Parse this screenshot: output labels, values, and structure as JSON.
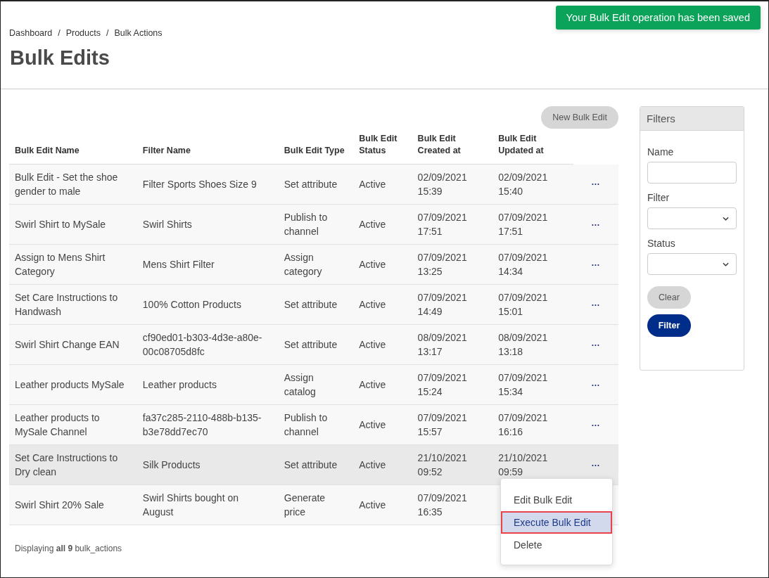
{
  "toast": {
    "text": "Your Bulk Edit operation has been saved"
  },
  "breadcrumb": [
    "Dashboard",
    "Products",
    "Bulk Actions"
  ],
  "breadcrumb_separator": "/",
  "title": "Bulk Edits",
  "new_button": "New Bulk Edit",
  "table": {
    "columns": [
      "Bulk Edit Name",
      "Filter Name",
      "Bulk Edit Type",
      "Bulk Edit Status",
      "Bulk Edit Created at",
      "Bulk Edit Updated at"
    ],
    "rows": [
      {
        "name": "Bulk Edit - Set the shoe gender to male",
        "filter": "Filter Sports Shoes Size 9",
        "type": "Set attribute",
        "status": "Active",
        "created": [
          "02/09/2021",
          "15:39"
        ],
        "updated": [
          "02/09/2021",
          "15:40"
        ],
        "actions": "···",
        "hovered": false
      },
      {
        "name": "Swirl Shirt to MySale",
        "filter": "Swirl Shirts",
        "type": "Publish to channel",
        "status": "Active",
        "created": [
          "07/09/2021",
          "17:51"
        ],
        "updated": [
          "07/09/2021",
          "17:51"
        ],
        "actions": "···",
        "hovered": false
      },
      {
        "name": "Assign to Mens Shirt Category",
        "filter": "Mens Shirt Filter",
        "type": "Assign category",
        "status": "Active",
        "created": [
          "07/09/2021",
          "13:25"
        ],
        "updated": [
          "07/09/2021",
          "14:34"
        ],
        "actions": "···",
        "hovered": false
      },
      {
        "name": "Set Care Instructions to Handwash",
        "filter": "100% Cotton Products",
        "type": "Set attribute",
        "status": "Active",
        "created": [
          "07/09/2021",
          "14:49"
        ],
        "updated": [
          "07/09/2021",
          "15:01"
        ],
        "actions": "···",
        "hovered": false
      },
      {
        "name": "Swirl Shirt Change EAN",
        "filter": "cf90ed01-b303-4d3e-a80e-00c08705d8fc",
        "type": "Set attribute",
        "status": "Active",
        "created": [
          "08/09/2021",
          "13:17"
        ],
        "updated": [
          "08/09/2021",
          "13:18"
        ],
        "actions": "···",
        "hovered": false
      },
      {
        "name": "Leather products MySale",
        "filter": "Leather products",
        "type": "Assign catalog",
        "status": "Active",
        "created": [
          "07/09/2021",
          "15:24"
        ],
        "updated": [
          "07/09/2021",
          "15:34"
        ],
        "actions": "···",
        "hovered": false
      },
      {
        "name": "Leather products to MySale Channel",
        "filter": "fa37c285-2110-488b-b135-b3e78dd7ec70",
        "type": "Publish to channel",
        "status": "Active",
        "created": [
          "07/09/2021",
          "15:57"
        ],
        "updated": [
          "07/09/2021",
          "16:16"
        ],
        "actions": "···",
        "hovered": false
      },
      {
        "name": "Set Care Instructions to Dry clean",
        "filter": "Silk Products",
        "type": "Set attribute",
        "status": "Active",
        "created": [
          "21/10/2021",
          "09:52"
        ],
        "updated": [
          "21/10/2021",
          "09:59"
        ],
        "actions": "···",
        "hovered": true
      },
      {
        "name": "Swirl Shirt 20% Sale",
        "filter": "Swirl Shirts bought on August",
        "type": "Generate price",
        "status": "Active",
        "created": [
          "07/09/2021",
          "16:35"
        ],
        "hovered": false
      }
    ]
  },
  "footer": "Displaying **all 9** bulk_actions",
  "menu": {
    "items": [
      {
        "label": "Edit Bulk Edit",
        "selected": false
      },
      {
        "label": "Execute Bulk Edit",
        "selected": true
      },
      {
        "label": "Delete",
        "selected": false
      }
    ]
  },
  "filters": {
    "title": "Filters",
    "fields": [
      {
        "label": "Name",
        "kind": "text"
      },
      {
        "label": "Filter",
        "kind": "select"
      },
      {
        "label": "Status",
        "kind": "select"
      }
    ],
    "clear_button": "Clear",
    "filter_button": "Filter"
  }
}
